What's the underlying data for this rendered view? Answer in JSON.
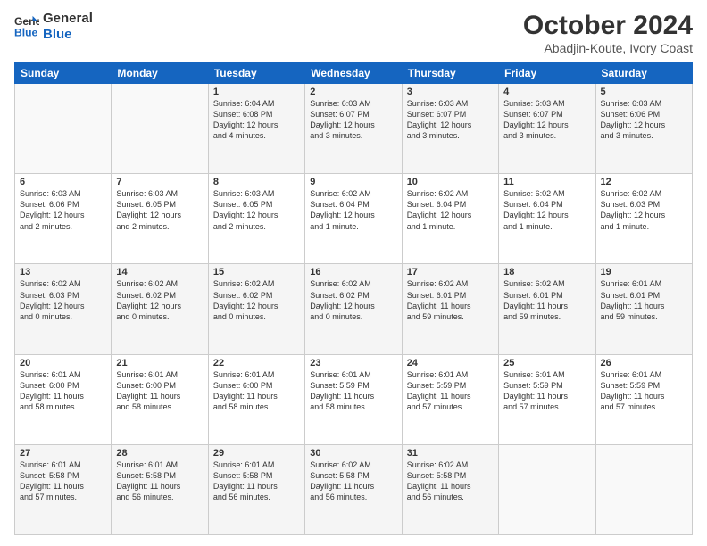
{
  "logo": {
    "line1": "General",
    "line2": "Blue"
  },
  "title": "October 2024",
  "subtitle": "Abadjin-Koute, Ivory Coast",
  "weekdays": [
    "Sunday",
    "Monday",
    "Tuesday",
    "Wednesday",
    "Thursday",
    "Friday",
    "Saturday"
  ],
  "weeks": [
    [
      {
        "day": "",
        "info": ""
      },
      {
        "day": "",
        "info": ""
      },
      {
        "day": "1",
        "info": "Sunrise: 6:04 AM\nSunset: 6:08 PM\nDaylight: 12 hours\nand 4 minutes."
      },
      {
        "day": "2",
        "info": "Sunrise: 6:03 AM\nSunset: 6:07 PM\nDaylight: 12 hours\nand 3 minutes."
      },
      {
        "day": "3",
        "info": "Sunrise: 6:03 AM\nSunset: 6:07 PM\nDaylight: 12 hours\nand 3 minutes."
      },
      {
        "day": "4",
        "info": "Sunrise: 6:03 AM\nSunset: 6:07 PM\nDaylight: 12 hours\nand 3 minutes."
      },
      {
        "day": "5",
        "info": "Sunrise: 6:03 AM\nSunset: 6:06 PM\nDaylight: 12 hours\nand 3 minutes."
      }
    ],
    [
      {
        "day": "6",
        "info": "Sunrise: 6:03 AM\nSunset: 6:06 PM\nDaylight: 12 hours\nand 2 minutes."
      },
      {
        "day": "7",
        "info": "Sunrise: 6:03 AM\nSunset: 6:05 PM\nDaylight: 12 hours\nand 2 minutes."
      },
      {
        "day": "8",
        "info": "Sunrise: 6:03 AM\nSunset: 6:05 PM\nDaylight: 12 hours\nand 2 minutes."
      },
      {
        "day": "9",
        "info": "Sunrise: 6:02 AM\nSunset: 6:04 PM\nDaylight: 12 hours\nand 1 minute."
      },
      {
        "day": "10",
        "info": "Sunrise: 6:02 AM\nSunset: 6:04 PM\nDaylight: 12 hours\nand 1 minute."
      },
      {
        "day": "11",
        "info": "Sunrise: 6:02 AM\nSunset: 6:04 PM\nDaylight: 12 hours\nand 1 minute."
      },
      {
        "day": "12",
        "info": "Sunrise: 6:02 AM\nSunset: 6:03 PM\nDaylight: 12 hours\nand 1 minute."
      }
    ],
    [
      {
        "day": "13",
        "info": "Sunrise: 6:02 AM\nSunset: 6:03 PM\nDaylight: 12 hours\nand 0 minutes."
      },
      {
        "day": "14",
        "info": "Sunrise: 6:02 AM\nSunset: 6:02 PM\nDaylight: 12 hours\nand 0 minutes."
      },
      {
        "day": "15",
        "info": "Sunrise: 6:02 AM\nSunset: 6:02 PM\nDaylight: 12 hours\nand 0 minutes."
      },
      {
        "day": "16",
        "info": "Sunrise: 6:02 AM\nSunset: 6:02 PM\nDaylight: 12 hours\nand 0 minutes."
      },
      {
        "day": "17",
        "info": "Sunrise: 6:02 AM\nSunset: 6:01 PM\nDaylight: 11 hours\nand 59 minutes."
      },
      {
        "day": "18",
        "info": "Sunrise: 6:02 AM\nSunset: 6:01 PM\nDaylight: 11 hours\nand 59 minutes."
      },
      {
        "day": "19",
        "info": "Sunrise: 6:01 AM\nSunset: 6:01 PM\nDaylight: 11 hours\nand 59 minutes."
      }
    ],
    [
      {
        "day": "20",
        "info": "Sunrise: 6:01 AM\nSunset: 6:00 PM\nDaylight: 11 hours\nand 58 minutes."
      },
      {
        "day": "21",
        "info": "Sunrise: 6:01 AM\nSunset: 6:00 PM\nDaylight: 11 hours\nand 58 minutes."
      },
      {
        "day": "22",
        "info": "Sunrise: 6:01 AM\nSunset: 6:00 PM\nDaylight: 11 hours\nand 58 minutes."
      },
      {
        "day": "23",
        "info": "Sunrise: 6:01 AM\nSunset: 5:59 PM\nDaylight: 11 hours\nand 58 minutes."
      },
      {
        "day": "24",
        "info": "Sunrise: 6:01 AM\nSunset: 5:59 PM\nDaylight: 11 hours\nand 57 minutes."
      },
      {
        "day": "25",
        "info": "Sunrise: 6:01 AM\nSunset: 5:59 PM\nDaylight: 11 hours\nand 57 minutes."
      },
      {
        "day": "26",
        "info": "Sunrise: 6:01 AM\nSunset: 5:59 PM\nDaylight: 11 hours\nand 57 minutes."
      }
    ],
    [
      {
        "day": "27",
        "info": "Sunrise: 6:01 AM\nSunset: 5:58 PM\nDaylight: 11 hours\nand 57 minutes."
      },
      {
        "day": "28",
        "info": "Sunrise: 6:01 AM\nSunset: 5:58 PM\nDaylight: 11 hours\nand 56 minutes."
      },
      {
        "day": "29",
        "info": "Sunrise: 6:01 AM\nSunset: 5:58 PM\nDaylight: 11 hours\nand 56 minutes."
      },
      {
        "day": "30",
        "info": "Sunrise: 6:02 AM\nSunset: 5:58 PM\nDaylight: 11 hours\nand 56 minutes."
      },
      {
        "day": "31",
        "info": "Sunrise: 6:02 AM\nSunset: 5:58 PM\nDaylight: 11 hours\nand 56 minutes."
      },
      {
        "day": "",
        "info": ""
      },
      {
        "day": "",
        "info": ""
      }
    ]
  ]
}
